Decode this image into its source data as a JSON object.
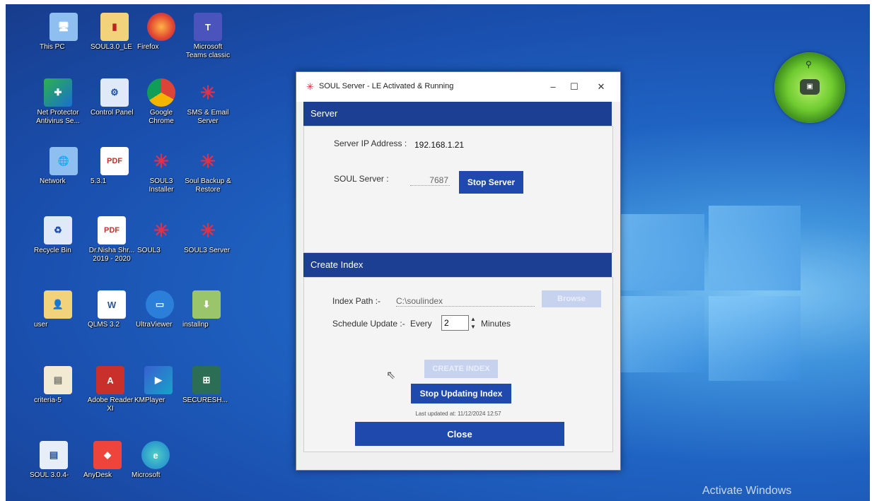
{
  "desktop": {
    "icons": [
      {
        "label": "This PC"
      },
      {
        "label": "SOUL3.0_LE"
      },
      {
        "label": "Firefox"
      },
      {
        "label": "Microsoft Teams classic"
      },
      {
        "label": "Net Protector Antivirus Se..."
      },
      {
        "label": "Control Panel"
      },
      {
        "label": "Google Chrome"
      },
      {
        "label": "SMS & Email Server"
      },
      {
        "label": "Network"
      },
      {
        "label": "5.3.1"
      },
      {
        "label": "SOUL3 Installer"
      },
      {
        "label": "Soul Backup & Restore"
      },
      {
        "label": "Recycle Bin"
      },
      {
        "label": "Dr.Nisha Shr... 2019 - 2020"
      },
      {
        "label": "SOUL3"
      },
      {
        "label": "SOUL3 Server"
      },
      {
        "label": "user"
      },
      {
        "label": "QLMS 3.2"
      },
      {
        "label": "UltraViewer"
      },
      {
        "label": "installnp"
      },
      {
        "label": "criteria-5"
      },
      {
        "label": "Adobe Reader XI"
      },
      {
        "label": "KMPlayer"
      },
      {
        "label": "SECURESH..."
      },
      {
        "label": "SOUL 3.0.4-"
      },
      {
        "label": "AnyDesk"
      },
      {
        "label": "Microsoft"
      }
    ],
    "activate_text": "Activate Windows"
  },
  "window": {
    "title": "SOUL Server - LE Activated & Running",
    "controls": {
      "minimize": "–",
      "maximize": "☐",
      "close": "✕"
    }
  },
  "server": {
    "section_title": "Server",
    "ip_label": "Server IP Address :",
    "ip_value": "192.168.1.21",
    "port_label": "SOUL Server :",
    "port_value": "7687",
    "stop_server_label": "Stop Server"
  },
  "index": {
    "section_title": "Create Index",
    "path_label": "Index Path :-",
    "path_value": "C:\\soulindex",
    "browse_label": "Browse",
    "schedule_label": "Schedule Update :-",
    "every_label": "Every",
    "every_value": "2",
    "minutes_label": "Minutes",
    "create_index_label": "CREATE INDEX",
    "stop_updating_label": "Stop Updating Index",
    "last_updated": "Last updated at: 11/12/2024 12:57",
    "close_label": "Close"
  },
  "colors": {
    "band": "#1d3f93",
    "button": "#1f49ad",
    "desktop": "#1a4fae"
  }
}
